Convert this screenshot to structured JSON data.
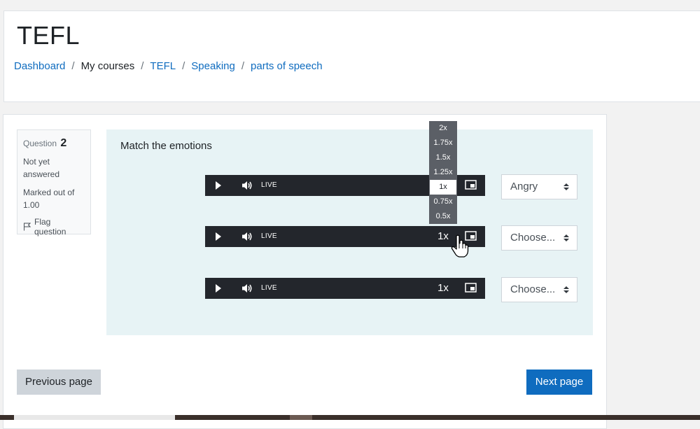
{
  "header": {
    "course_title": "TEFL",
    "breadcrumb": [
      "Dashboard",
      "My courses",
      "TEFL",
      "Speaking",
      "parts of speech"
    ]
  },
  "question_info": {
    "question_label": "Question",
    "question_number": "2",
    "state": "Not yet answered",
    "grade": "Marked out of 1.00",
    "flag_label": "Flag question"
  },
  "question": {
    "prompt": "Match the emotions",
    "rows": [
      {
        "live_label": "LIVE",
        "rate": "1x",
        "answer": "Angry"
      },
      {
        "live_label": "LIVE",
        "rate": "1x",
        "answer": "Choose..."
      },
      {
        "live_label": "LIVE",
        "rate": "1x",
        "answer": "Choose..."
      }
    ],
    "rate_menu": [
      "2x",
      "1.75x",
      "1.5x",
      "1.25x",
      "1x",
      "0.75x",
      "0.5x"
    ],
    "rate_menu_selected": "1x"
  },
  "navigation": {
    "prev_label": "Previous page",
    "next_label": "Next page"
  },
  "colors": {
    "link": "#0f6cbf",
    "primary_button": "#0f6cbf",
    "player_bg": "#23262c",
    "content_bg": "#e7f3f5"
  }
}
